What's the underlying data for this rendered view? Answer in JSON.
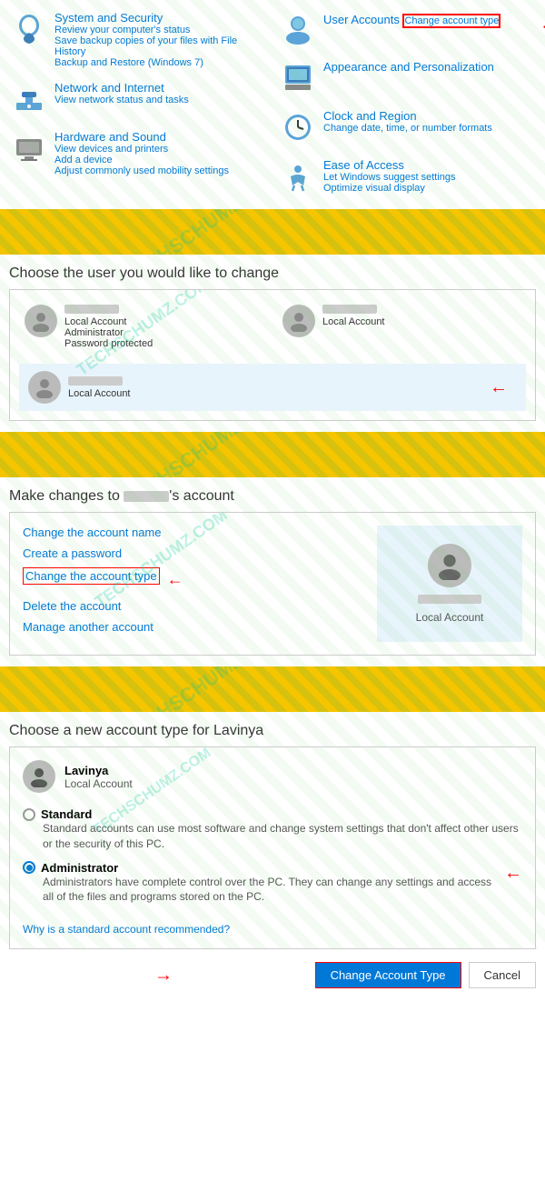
{
  "section1": {
    "items_left": [
      {
        "id": "system-security",
        "title": "System and Security",
        "links": [
          "Review your computer's status",
          "Save backup copies of your files with File History",
          "Backup and Restore (Windows 7)"
        ],
        "icon_color": "#0078d7"
      },
      {
        "id": "network-internet",
        "title": "Network and Internet",
        "links": [
          "View network status and tasks"
        ],
        "icon_color": "#0078d7"
      },
      {
        "id": "hardware-sound",
        "title": "Hardware and Sound",
        "links": [
          "View devices and printers",
          "Add a device",
          "Adjust commonly used mobility settings"
        ],
        "icon_color": "#555"
      }
    ],
    "items_right": [
      {
        "id": "user-accounts",
        "title": "User Accounts",
        "links": [
          "Change account type"
        ],
        "icon_color": "#0078d7"
      },
      {
        "id": "appearance",
        "title": "Appearance and Personalization",
        "icon_color": "#0078d7"
      },
      {
        "id": "clock-region",
        "title": "Clock and Region",
        "links": [
          "Change date, time, or number formats"
        ],
        "icon_color": "#0078d7"
      },
      {
        "id": "ease-access",
        "title": "Ease of Access",
        "links": [
          "Let Windows suggest settings",
          "Optimize visual display"
        ],
        "icon_color": "#0078d7"
      }
    ]
  },
  "section2": {
    "heading": "Choose the user you would like to change",
    "users": [
      {
        "role": "Local Account",
        "extra": "Administrator\nPassword protected"
      },
      {
        "role": "Local Account"
      },
      {
        "role": "Local Account"
      }
    ]
  },
  "section3": {
    "heading": "Make changes to [name]'s account",
    "heading_prefix": "Make changes to ",
    "heading_suffix": "'s account",
    "links": [
      "Change the account name",
      "Create a password",
      "Change the account type",
      "Delete the account",
      "Manage another account"
    ],
    "account_role": "Local Account"
  },
  "section4": {
    "heading": "Choose a new account type for Lavinya",
    "user_name": "Lavinya",
    "user_role": "Local Account",
    "options": [
      {
        "id": "standard",
        "label": "Standard",
        "desc": "Standard accounts can use most software and change system settings that don't affect other users or the security of this PC."
      },
      {
        "id": "administrator",
        "label": "Administrator",
        "desc": "Administrators have complete control over the PC. They can change any settings and access all of the files and programs stored on the PC.",
        "selected": true
      }
    ],
    "why_link": "Why is a standard account recommended?",
    "btn_change": "Change Account Type",
    "btn_cancel": "Cancel"
  }
}
